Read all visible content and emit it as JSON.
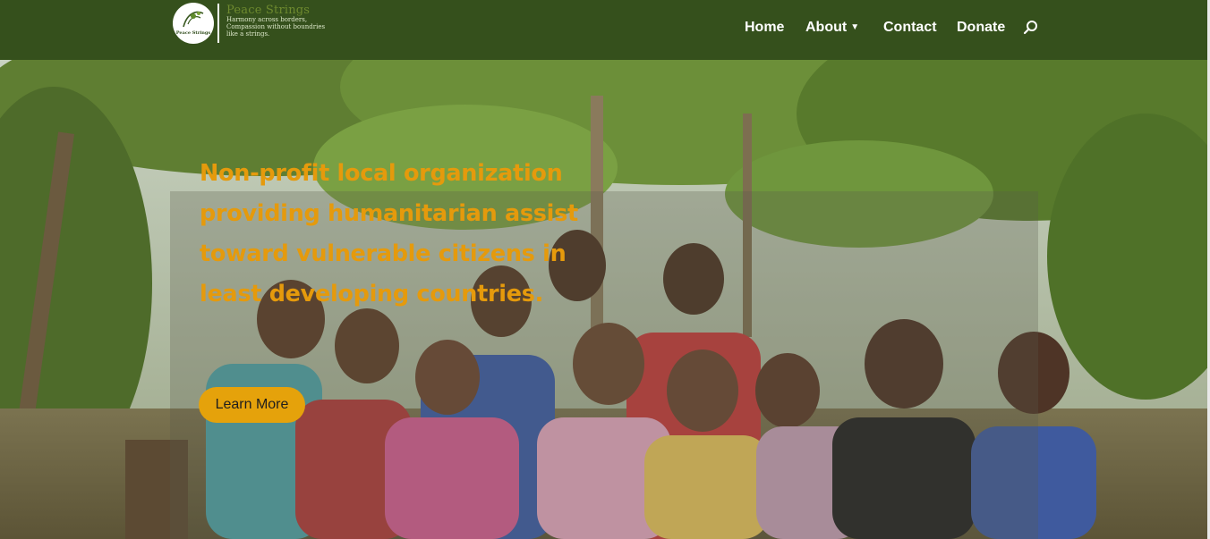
{
  "brand": {
    "name": "Peace Strings",
    "tagline_line1": "Harmony across borders,",
    "tagline_line2": "Compassion without boundries",
    "tagline_line3": "like a strings.",
    "logo_text": "Peace Strings"
  },
  "nav": {
    "items": [
      "Home",
      "About",
      "Contact",
      "Donate"
    ],
    "about_has_dropdown": true,
    "search_icon": "search-icon"
  },
  "hero": {
    "headline": "Non-profit local organization providing humanitarian assist toward vulnerable citizens in least developing countries.",
    "cta_label": "Learn More"
  },
  "colors": {
    "header_bg": "#35501c",
    "headline": "#e59a0c",
    "cta_bg": "#e5a20b"
  }
}
